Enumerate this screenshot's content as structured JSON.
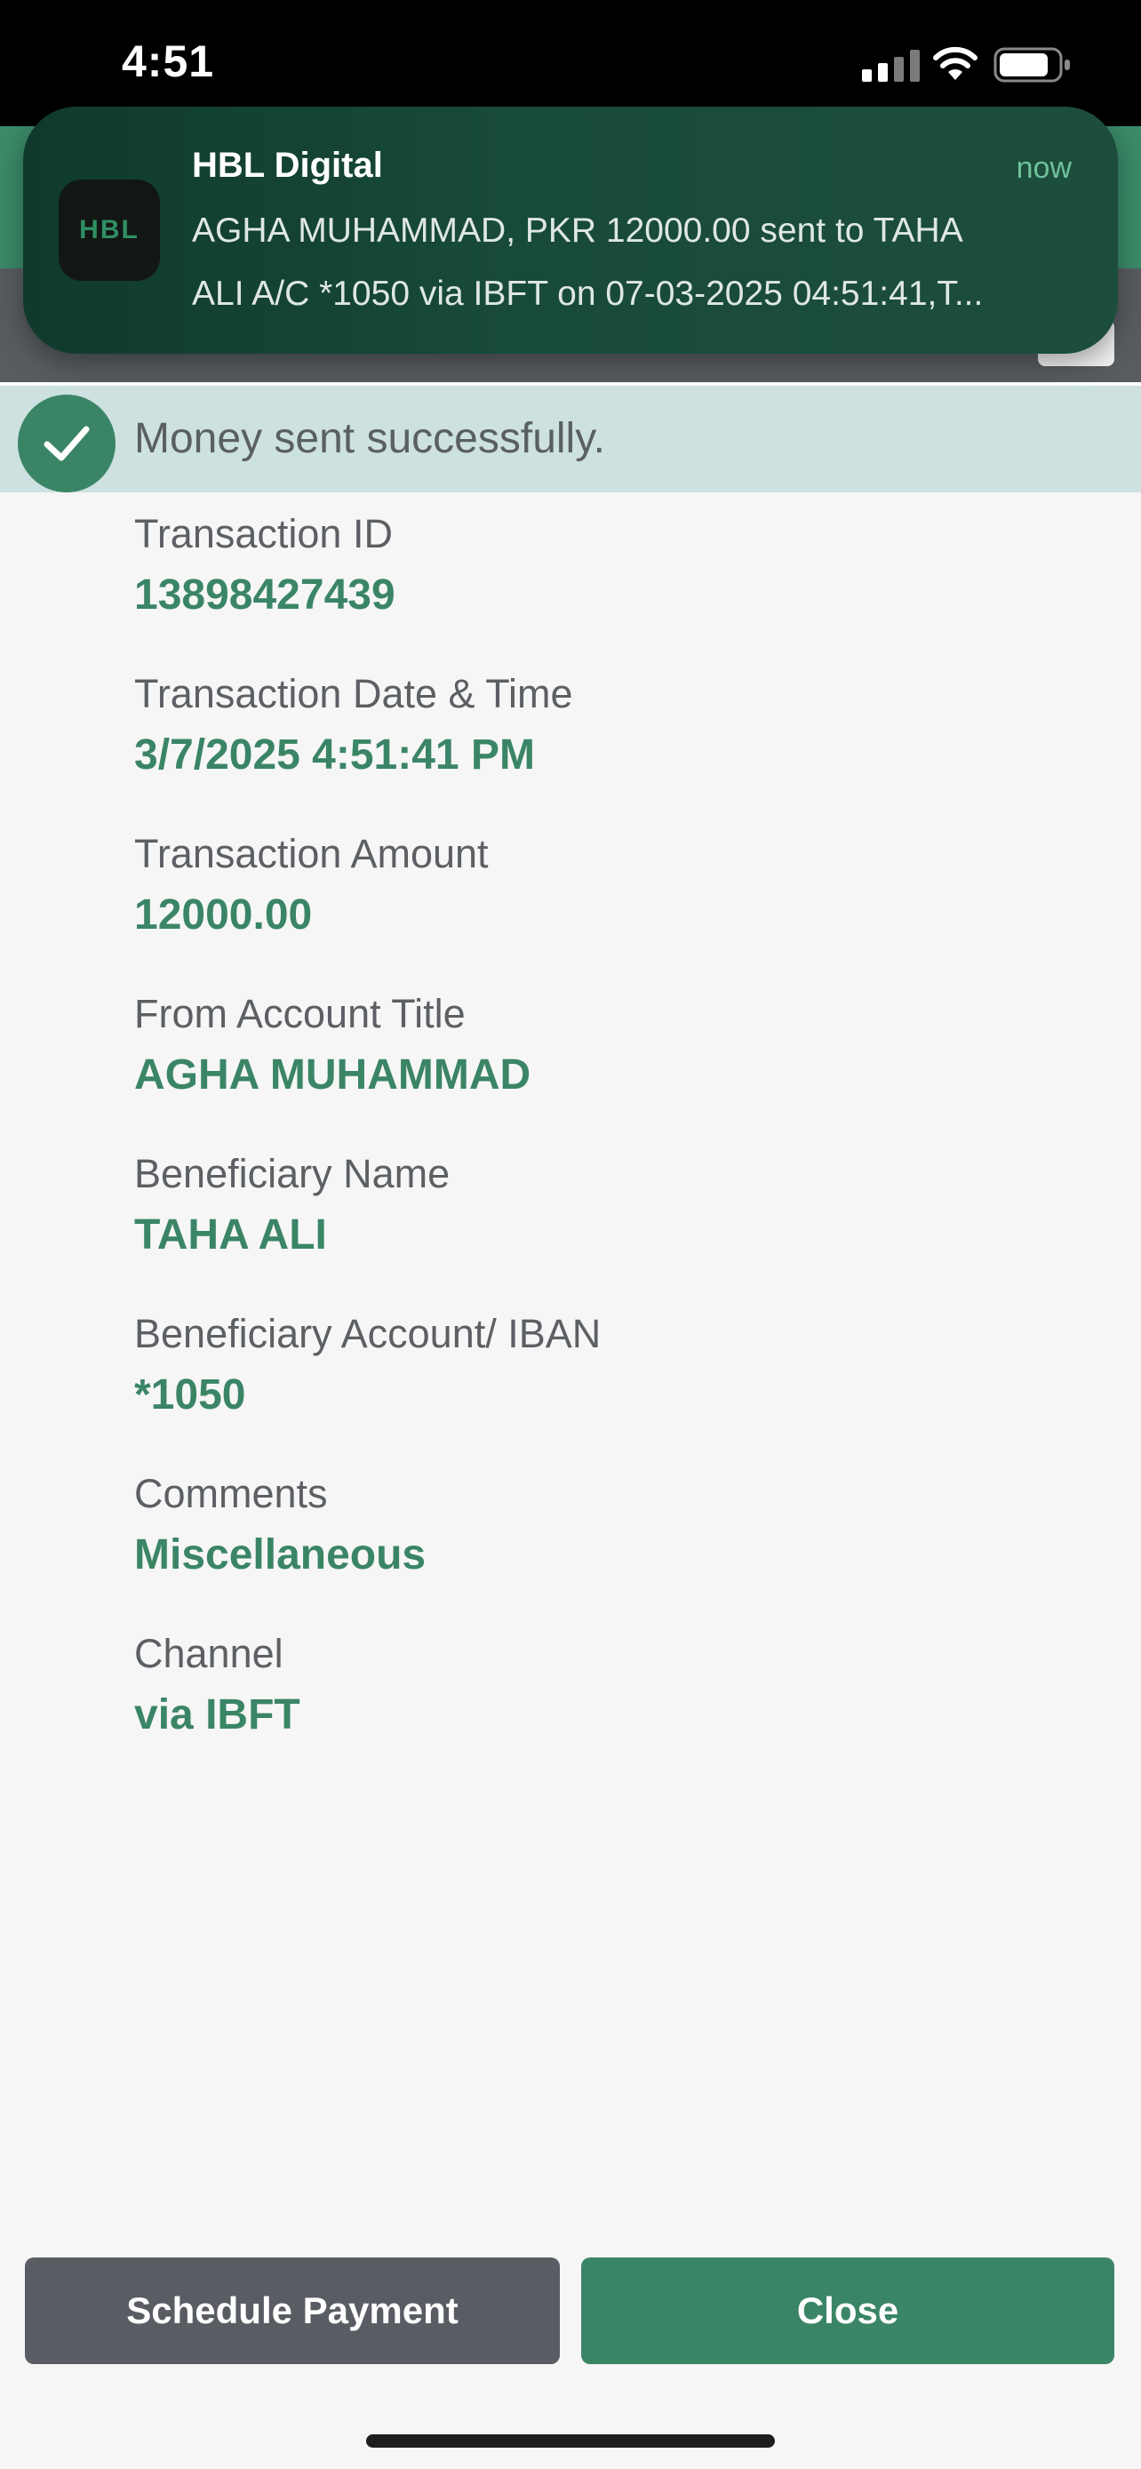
{
  "status_bar": {
    "time": "4:51"
  },
  "notification": {
    "app_name": "HBL Digital",
    "app_icon_text": "HBL",
    "time": "now",
    "line1": "AGHA MUHAMMAD, PKR 12000.00 sent to TAHA",
    "line2": "ALI A/C *1050 via IBFT on 07-03-2025 04:51:41,T..."
  },
  "banner": {
    "message": "Money sent successfully."
  },
  "details": [
    {
      "label": "Transaction ID",
      "value": "13898427439"
    },
    {
      "label": "Transaction Date & Time",
      "value": "3/7/2025 4:51:41 PM"
    },
    {
      "label": "Transaction Amount",
      "value": "12000.00"
    },
    {
      "label": "From Account Title",
      "value": "AGHA MUHAMMAD"
    },
    {
      "label": "Beneficiary Name",
      "value": "TAHA ALI"
    },
    {
      "label": "Beneficiary Account/ IBAN",
      "value": "*1050"
    },
    {
      "label": "Comments",
      "value": "Miscellaneous"
    },
    {
      "label": "Channel",
      "value": "via IBFT"
    }
  ],
  "buttons": {
    "schedule": "Schedule Payment",
    "close": "Close"
  },
  "colors": {
    "brand_green": "#3b8567",
    "banner_bg": "#cde1e0",
    "button_gray": "#595d63"
  }
}
